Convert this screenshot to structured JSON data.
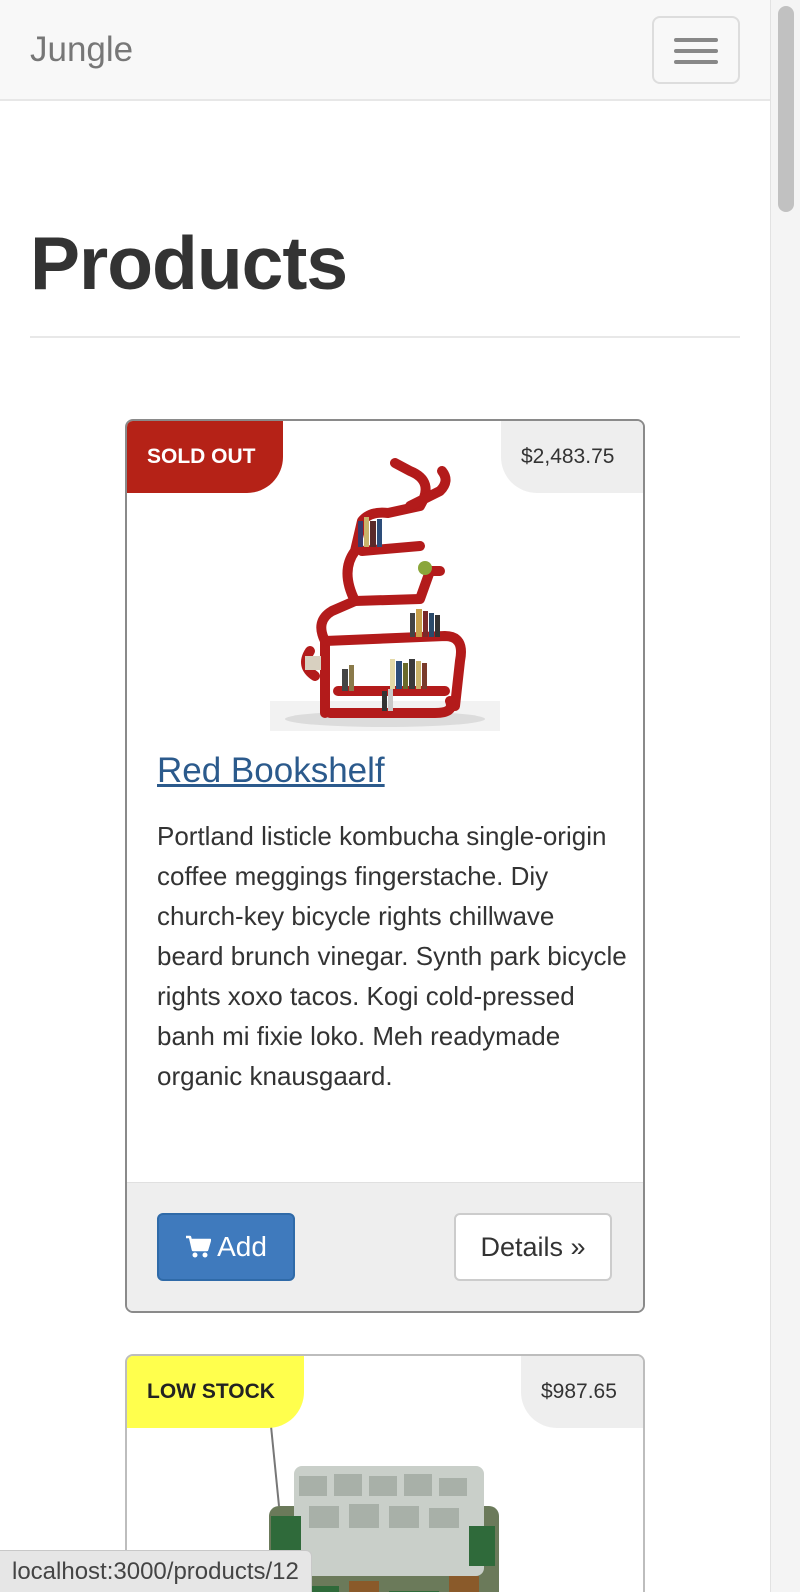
{
  "navbar": {
    "brand": "Jungle",
    "menu_icon": "hamburger-menu-icon"
  },
  "page": {
    "title": "Products"
  },
  "products": [
    {
      "stock_label": "SOLD OUT",
      "stock_color": "#b52217",
      "price": "$2,483.75",
      "name": "Red Bookshelf",
      "image_alt": "red bookshelf with books",
      "description": "Portland listicle kombucha single-origin coffee meggings fingerstache. Diy church-key bicycle rights chillwave beard brunch vinegar. Synth park bicycle rights xoxo tacos. Kogi cold-pressed banh mi fixie loko. Meh readymade organic knausgaard.",
      "add_label": "Add",
      "add_icon": "shopping-cart-icon",
      "details_label": "Details »"
    },
    {
      "stock_label": "LOW STOCK",
      "stock_color": "#ffff4d",
      "price": "$987.65",
      "image_alt": "armchair made of circuit boards"
    }
  ],
  "status_bar": {
    "url": "localhost:3000/products/12"
  },
  "colors": {
    "link": "#2b5a8c",
    "primary_button": "#3f7abd",
    "sold_out": "#b52217",
    "low_stock": "#ffff4d"
  }
}
